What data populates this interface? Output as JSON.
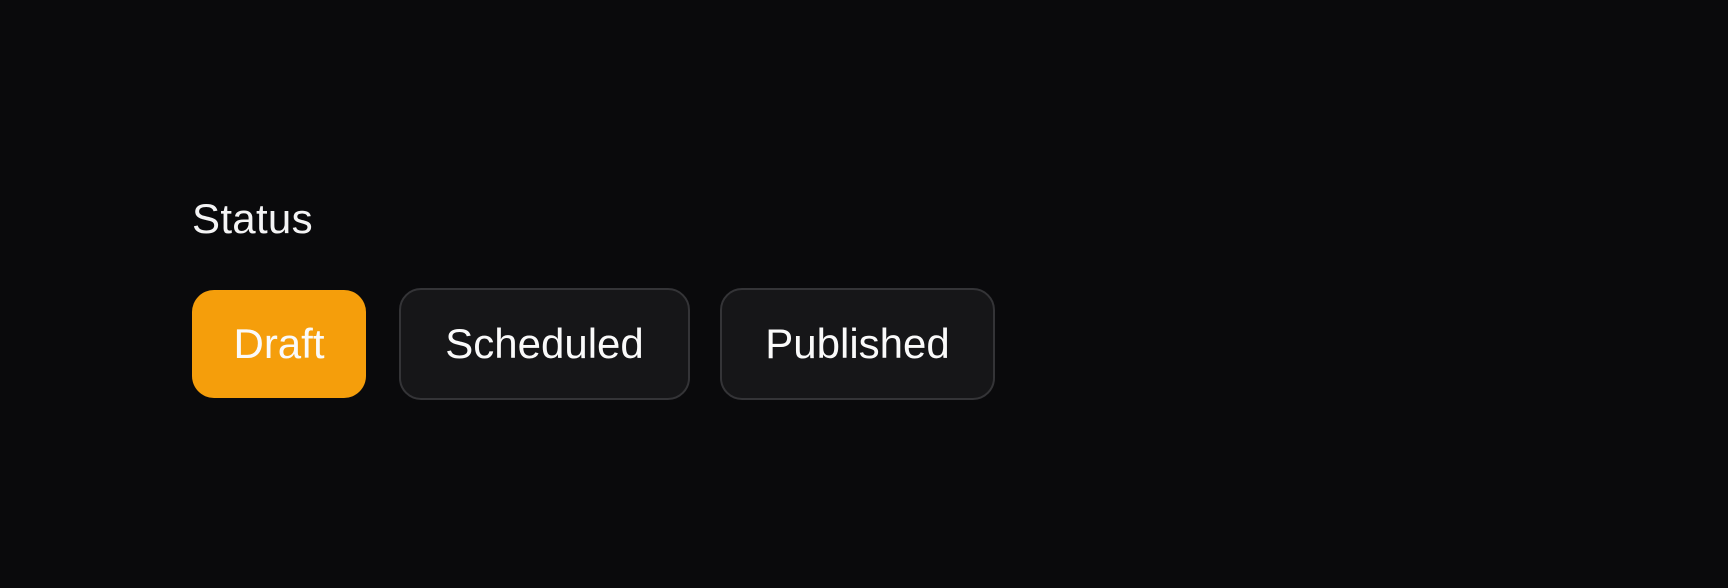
{
  "status": {
    "label": "Status",
    "selected": "Draft",
    "options": [
      {
        "label": "Draft",
        "active": true
      },
      {
        "label": "Scheduled",
        "active": false
      },
      {
        "label": "Published",
        "active": false
      }
    ]
  },
  "colors": {
    "background": "#0a0a0c",
    "accent": "#f59e0b",
    "segment_bg": "#161618",
    "segment_border": "#343437",
    "text": "#fafafa"
  }
}
